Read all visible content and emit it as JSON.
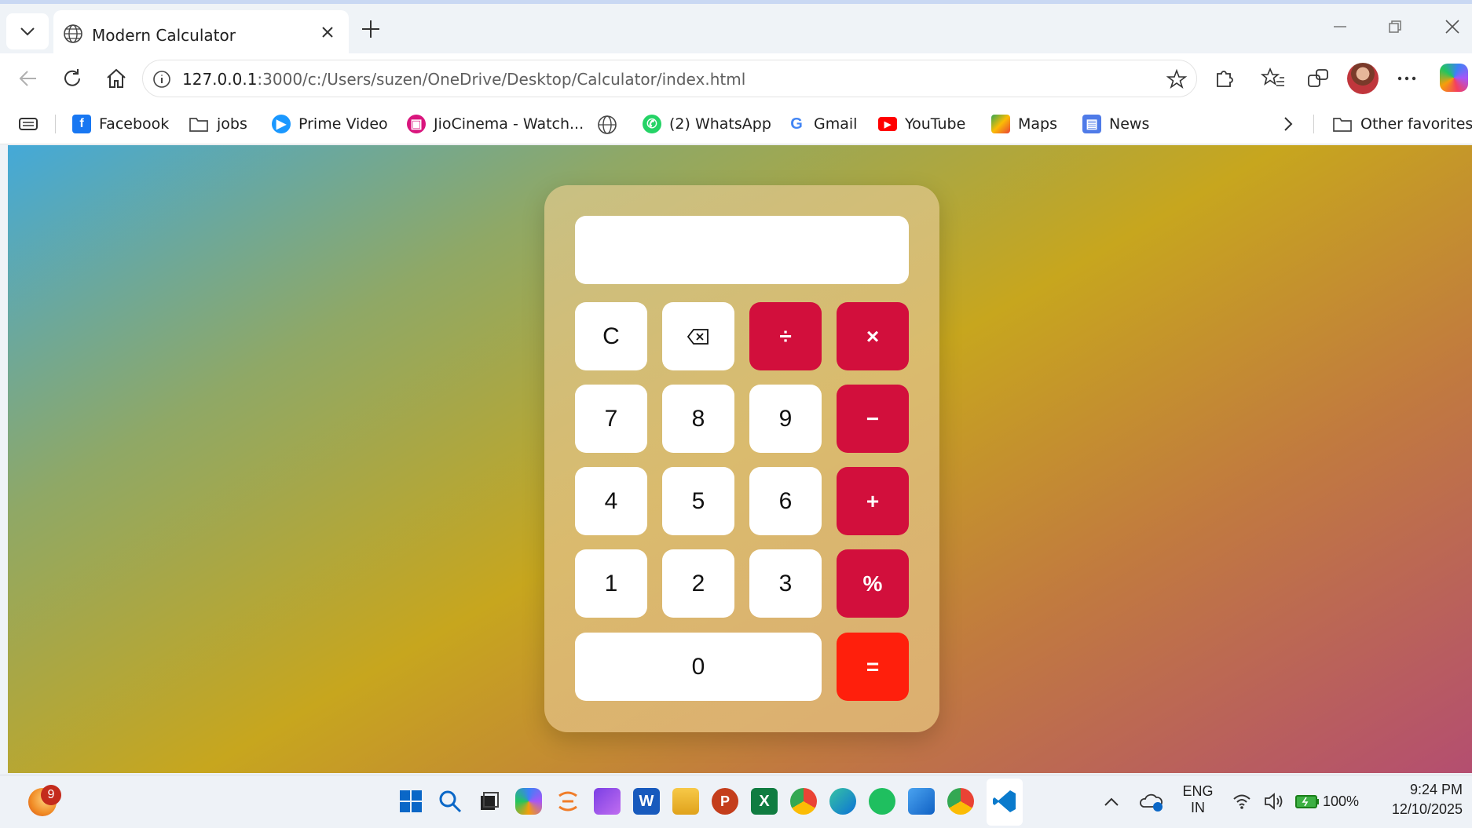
{
  "browser": {
    "tab_title": "Modern Calculator",
    "url_host": "127.0.0.1",
    "url_rest": ":3000/c:/Users/suzen/OneDrive/Desktop/Calculator/index.html"
  },
  "favorites": [
    {
      "label": "Facebook",
      "icon": "facebook-icon",
      "color": "#1877f2"
    },
    {
      "label": "jobs",
      "icon": "folder-icon",
      "color": "#444444"
    },
    {
      "label": "Prime Video",
      "icon": "prime-video-icon",
      "color": "#1a98ff"
    },
    {
      "label": "JioCinema - Watch...",
      "icon": "jiocinema-icon",
      "color": "#d9157d"
    },
    {
      "label": "(2) WhatsApp",
      "icon": "whatsapp-icon",
      "color": "#25d366"
    },
    {
      "label": "Gmail",
      "icon": "google-icon",
      "color": "#4285f4"
    },
    {
      "label": "YouTube",
      "icon": "youtube-icon",
      "color": "#ff0000"
    },
    {
      "label": "Maps",
      "icon": "maps-icon",
      "color": "#34a853"
    },
    {
      "label": "News",
      "icon": "news-icon",
      "color": "#4f7be8"
    }
  ],
  "other_favorites": "Other favorites",
  "calculator": {
    "display_value": "",
    "buttons": {
      "clear": "C",
      "backspace": "⌫",
      "divide": "÷",
      "multiply": "×",
      "seven": "7",
      "eight": "8",
      "nine": "9",
      "minus": "−",
      "four": "4",
      "five": "5",
      "six": "6",
      "plus": "+",
      "one": "1",
      "two": "2",
      "three": "3",
      "percent": "%",
      "zero": "0",
      "equals": "="
    },
    "colors": {
      "operator": "#d20f3c",
      "equals": "#ff1f0c"
    }
  },
  "taskbar": {
    "notification_count": "9",
    "language_line1": "ENG",
    "language_line2": "IN",
    "battery": "100%",
    "time": "9:24 PM",
    "date": "12/10/2025"
  }
}
